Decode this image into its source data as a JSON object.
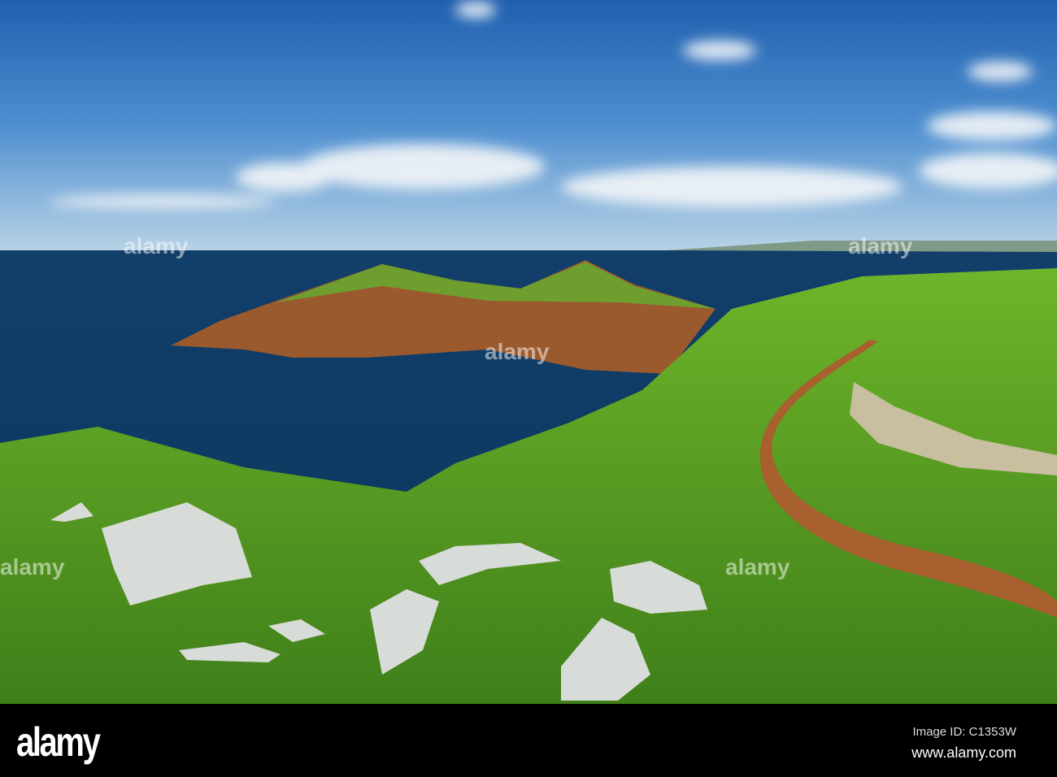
{
  "photo": {
    "subject": "coastal-headland-landscape",
    "watermark": "alamy"
  },
  "footer": {
    "logo": "alamy",
    "image_id": "Image ID: C1353W",
    "url": "www.alamy.com"
  }
}
